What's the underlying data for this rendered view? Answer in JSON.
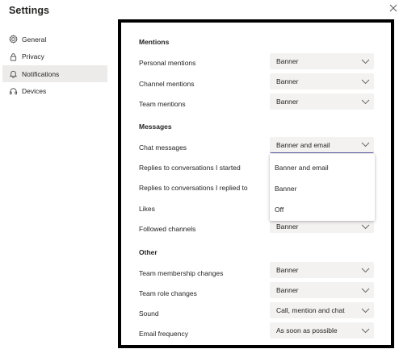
{
  "window": {
    "title": "Settings"
  },
  "sidebar": {
    "items": [
      {
        "label": "General",
        "icon": "gear-icon",
        "active": false
      },
      {
        "label": "Privacy",
        "icon": "lock-icon",
        "active": false
      },
      {
        "label": "Notifications",
        "icon": "bell-icon",
        "active": true
      },
      {
        "label": "Devices",
        "icon": "headset-icon",
        "active": false
      }
    ]
  },
  "mentions": {
    "heading": "Mentions",
    "rows": [
      {
        "label": "Personal mentions",
        "value": "Banner"
      },
      {
        "label": "Channel mentions",
        "value": "Banner"
      },
      {
        "label": "Team mentions",
        "value": "Banner"
      }
    ]
  },
  "messages": {
    "heading": "Messages",
    "rows": [
      {
        "label": "Chat messages",
        "value": "Banner and email",
        "open": true
      },
      {
        "label": "Replies to conversations I started",
        "value": ""
      },
      {
        "label": "Replies to conversations I replied to",
        "value": ""
      },
      {
        "label": "Likes",
        "value": ""
      },
      {
        "label": "Followed channels",
        "value": "Banner"
      }
    ]
  },
  "chat_menu": {
    "options": [
      "Banner and email",
      "Banner",
      "Off"
    ]
  },
  "other": {
    "heading": "Other",
    "rows": [
      {
        "label": "Team membership changes",
        "value": "Banner"
      },
      {
        "label": "Team role changes",
        "value": "Banner"
      },
      {
        "label": "Sound",
        "value": "Call, mention and chat"
      },
      {
        "label": "Email frequency",
        "value": "As soon as possible"
      }
    ]
  },
  "colors": {
    "accent": "#6264a7",
    "dropdown_bg": "#f3f2f1",
    "active_nav_bg": "#edebe9"
  }
}
